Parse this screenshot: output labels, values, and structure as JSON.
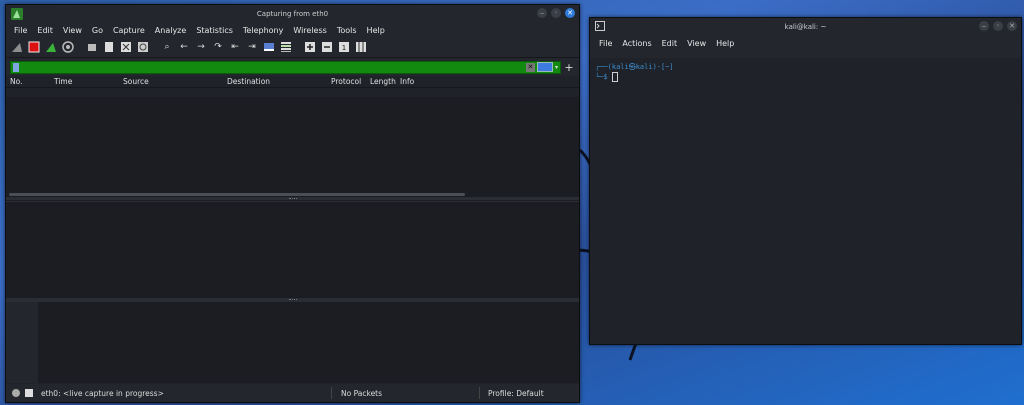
{
  "wireshark": {
    "title": "Capturing from eth0",
    "menu": [
      "File",
      "Edit",
      "View",
      "Go",
      "Capture",
      "Analyze",
      "Statistics",
      "Telephony",
      "Wireless",
      "Tools",
      "Help"
    ],
    "filter": {
      "value": "",
      "placeholder": ""
    },
    "columns": [
      "No.",
      "Time",
      "Source",
      "Destination",
      "Protocol",
      "Length",
      "Info"
    ],
    "status": {
      "interface_text": "eth0: <live capture in progress>",
      "packets": "No Packets",
      "profile": "Profile: Default"
    }
  },
  "terminal": {
    "title": "kali@kali: ~",
    "menu": [
      "File",
      "Actions",
      "Edit",
      "View",
      "Help"
    ],
    "prompt_line1": "┌──(kali㉿kali)-[~]",
    "prompt_line2": "└─$"
  },
  "colors": {
    "filter_bg": "#128a0f",
    "accent": "#2f7bd8",
    "prompt": "#3d8fd1"
  },
  "icons": [
    "shark-fin-icon",
    "stop-icon",
    "restart-icon",
    "options-gear-icon",
    "open-file-icon",
    "save-file-icon",
    "close-file-icon",
    "reload-icon",
    "find-icon",
    "back-arrow-icon",
    "forward-arrow-icon",
    "goto-icon",
    "first-packet-icon",
    "last-packet-icon",
    "autoscroll-icon",
    "colorize-icon",
    "zoom-in-icon",
    "zoom-out-icon",
    "normal-size-icon",
    "resize-columns-icon"
  ]
}
